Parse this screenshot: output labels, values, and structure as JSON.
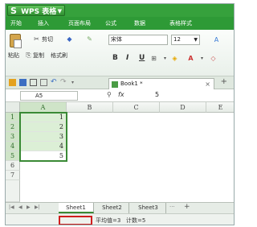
{
  "app": {
    "title": "WPS 表格",
    "logo_letter": "S"
  },
  "menu": {
    "tabs": [
      "开始",
      "插入",
      "页面布局",
      "公式",
      "数据",
      "表格样式"
    ]
  },
  "ribbon": {
    "paste_label": "粘贴",
    "cut_label": "剪切",
    "copy_label": "复制",
    "format_painter_label": "格式刷",
    "font_name": "宋体",
    "font_size": "12",
    "bold": "B",
    "italic": "I",
    "underline": "U"
  },
  "doc_tab": {
    "name": "Book1 *",
    "close": "×",
    "new_tab": "+"
  },
  "formula_bar": {
    "name_box": "A5",
    "fx": "fx",
    "value": "5"
  },
  "grid": {
    "columns": [
      "A",
      "B",
      "C",
      "D",
      "E"
    ],
    "rows": [
      "1",
      "2",
      "3",
      "4",
      "5",
      "6",
      "7"
    ],
    "column_a_values": [
      "1",
      "2",
      "3",
      "4",
      "5",
      "",
      ""
    ]
  },
  "sheets": {
    "tabs": [
      "Sheet1",
      "Sheet2",
      "Sheet3"
    ],
    "active": "Sheet1",
    "more": "···",
    "add": "+"
  },
  "status": {
    "average": "平均值=3",
    "count": "计数=5"
  }
}
